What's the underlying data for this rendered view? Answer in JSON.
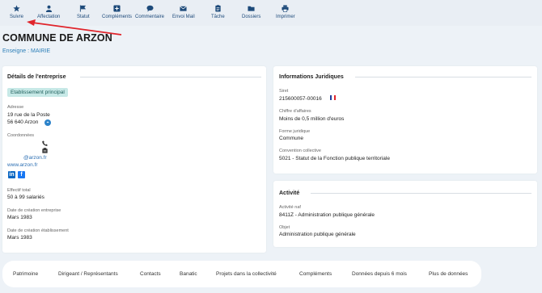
{
  "toolbar": {
    "items": [
      {
        "label": "Suivre",
        "icon": "star-icon"
      },
      {
        "label": "Affectation",
        "icon": "person-icon"
      },
      {
        "label": "Statut",
        "icon": "flag-icon"
      },
      {
        "label": "Compléments",
        "icon": "plus-square-icon"
      },
      {
        "label": "Commentaire",
        "icon": "comment-icon"
      },
      {
        "label": "Envoi Mail",
        "icon": "envelope-icon"
      },
      {
        "label": "Tâche",
        "icon": "clipboard-icon"
      },
      {
        "label": "Dossiers",
        "icon": "folder-icon"
      },
      {
        "label": "Imprimer",
        "icon": "printer-icon"
      }
    ]
  },
  "header": {
    "title": "COMMUNE DE ARZON",
    "enseigne": "Enseigne : MAIRIE"
  },
  "details": {
    "title": "Détails de l'entreprise",
    "badge": "Etablissement principal",
    "adresse_label": "Adresse",
    "adresse_line1": "19 rue de la Poste",
    "adresse_line2": "56 640 Arzon",
    "coordonnees_label": "Coordonnées",
    "email": "@arzon.fr",
    "website": "www.arzon.fr",
    "effectif_label": "Effectif total",
    "effectif": "50 à 99 salariés",
    "creation_entreprise_label": "Date de création entreprise",
    "creation_entreprise": "Mars 1983",
    "creation_etablissement_label": "Date de création établissement",
    "creation_etablissement": "Mars 1983"
  },
  "juridiques": {
    "title": "Informations Juridiques",
    "siret_label": "Siret",
    "siret": "215600057-00016",
    "ca_label": "Chiffre d'affaires",
    "ca": "Moins de 0,5 million d'euros",
    "forme_label": "Forme juridique",
    "forme": "Commune",
    "convention_label": "Convention collective",
    "convention": "5021 - Statut de la Fonction publique territoriale"
  },
  "activite": {
    "title": "Activité",
    "naf_label": "Activité naf",
    "naf": "8411Z - Administration publique générale",
    "objet_label": "Objet",
    "objet": "Administration publique générale"
  },
  "tabs": [
    "Patrimoine",
    "Dirigeant / Représentants",
    "Contacts",
    "Banatic",
    "Projets dans la collectivité",
    "Compléments",
    "Données depuis 6 mois",
    "Plus de données"
  ],
  "colors": {
    "accent": "#2c7fb8",
    "annotation_arrow": "#e0242b",
    "badge_bg": "#c7e9e7"
  }
}
